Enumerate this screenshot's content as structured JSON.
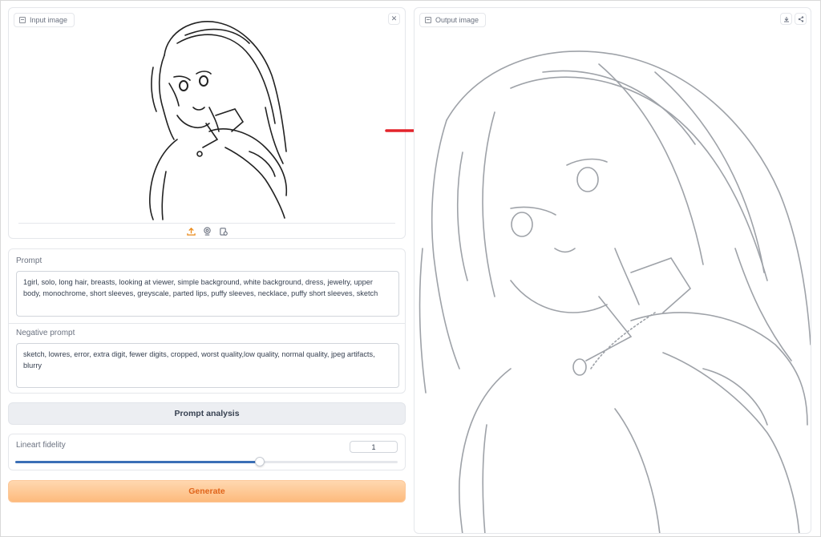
{
  "input_image": {
    "label": "Input image",
    "close_icon": "close-icon",
    "upload_icon": "upload-icon",
    "webcam_icon": "webcam-icon",
    "clipboard_icon": "clipboard-icon"
  },
  "output_image": {
    "label": "Output image",
    "download_icon": "download-icon",
    "share_icon": "share-icon"
  },
  "prompt": {
    "label": "Prompt",
    "value": "1girl, solo, long hair, breasts, looking at viewer, simple background, white background, dress, jewelry, upper body, monochrome, short sleeves, greyscale, parted lips, puffy sleeves, necklace, puffy short sleeves, sketch"
  },
  "negative_prompt": {
    "label": "Negative prompt",
    "value": "sketch, lowres, error, extra digit, fewer digits, cropped, worst quality,low quality, normal quality, jpeg artifacts, blurry"
  },
  "buttons": {
    "prompt_analysis": "Prompt analysis",
    "generate": "Generate"
  },
  "slider": {
    "label": "Lineart fidelity",
    "value": "1",
    "fill_fraction": 0.64
  },
  "colors": {
    "accent_orange": "#e0641a",
    "slider_blue": "#3b6fb6",
    "arrow_red": "#e3242b"
  }
}
